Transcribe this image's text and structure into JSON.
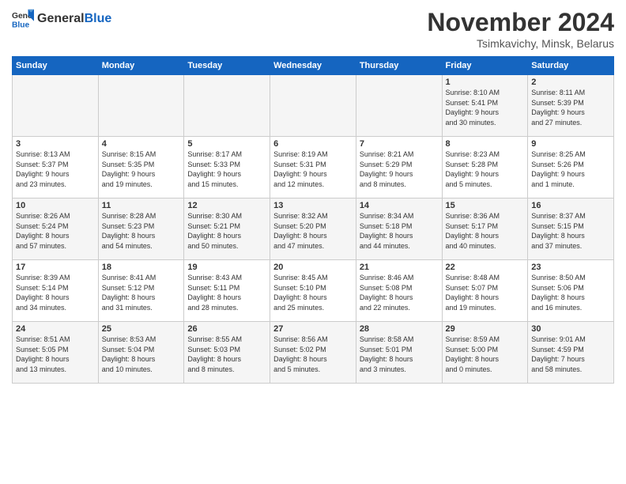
{
  "header": {
    "logo_general": "General",
    "logo_blue": "Blue",
    "month_title": "November 2024",
    "location": "Tsimkavichy, Minsk, Belarus"
  },
  "weekdays": [
    "Sunday",
    "Monday",
    "Tuesday",
    "Wednesday",
    "Thursday",
    "Friday",
    "Saturday"
  ],
  "weeks": [
    [
      {
        "day": "",
        "info": ""
      },
      {
        "day": "",
        "info": ""
      },
      {
        "day": "",
        "info": ""
      },
      {
        "day": "",
        "info": ""
      },
      {
        "day": "",
        "info": ""
      },
      {
        "day": "1",
        "info": "Sunrise: 8:10 AM\nSunset: 5:41 PM\nDaylight: 9 hours\nand 30 minutes."
      },
      {
        "day": "2",
        "info": "Sunrise: 8:11 AM\nSunset: 5:39 PM\nDaylight: 9 hours\nand 27 minutes."
      }
    ],
    [
      {
        "day": "3",
        "info": "Sunrise: 8:13 AM\nSunset: 5:37 PM\nDaylight: 9 hours\nand 23 minutes."
      },
      {
        "day": "4",
        "info": "Sunrise: 8:15 AM\nSunset: 5:35 PM\nDaylight: 9 hours\nand 19 minutes."
      },
      {
        "day": "5",
        "info": "Sunrise: 8:17 AM\nSunset: 5:33 PM\nDaylight: 9 hours\nand 15 minutes."
      },
      {
        "day": "6",
        "info": "Sunrise: 8:19 AM\nSunset: 5:31 PM\nDaylight: 9 hours\nand 12 minutes."
      },
      {
        "day": "7",
        "info": "Sunrise: 8:21 AM\nSunset: 5:29 PM\nDaylight: 9 hours\nand 8 minutes."
      },
      {
        "day": "8",
        "info": "Sunrise: 8:23 AM\nSunset: 5:28 PM\nDaylight: 9 hours\nand 5 minutes."
      },
      {
        "day": "9",
        "info": "Sunrise: 8:25 AM\nSunset: 5:26 PM\nDaylight: 9 hours\nand 1 minute."
      }
    ],
    [
      {
        "day": "10",
        "info": "Sunrise: 8:26 AM\nSunset: 5:24 PM\nDaylight: 8 hours\nand 57 minutes."
      },
      {
        "day": "11",
        "info": "Sunrise: 8:28 AM\nSunset: 5:23 PM\nDaylight: 8 hours\nand 54 minutes."
      },
      {
        "day": "12",
        "info": "Sunrise: 8:30 AM\nSunset: 5:21 PM\nDaylight: 8 hours\nand 50 minutes."
      },
      {
        "day": "13",
        "info": "Sunrise: 8:32 AM\nSunset: 5:20 PM\nDaylight: 8 hours\nand 47 minutes."
      },
      {
        "day": "14",
        "info": "Sunrise: 8:34 AM\nSunset: 5:18 PM\nDaylight: 8 hours\nand 44 minutes."
      },
      {
        "day": "15",
        "info": "Sunrise: 8:36 AM\nSunset: 5:17 PM\nDaylight: 8 hours\nand 40 minutes."
      },
      {
        "day": "16",
        "info": "Sunrise: 8:37 AM\nSunset: 5:15 PM\nDaylight: 8 hours\nand 37 minutes."
      }
    ],
    [
      {
        "day": "17",
        "info": "Sunrise: 8:39 AM\nSunset: 5:14 PM\nDaylight: 8 hours\nand 34 minutes."
      },
      {
        "day": "18",
        "info": "Sunrise: 8:41 AM\nSunset: 5:12 PM\nDaylight: 8 hours\nand 31 minutes."
      },
      {
        "day": "19",
        "info": "Sunrise: 8:43 AM\nSunset: 5:11 PM\nDaylight: 8 hours\nand 28 minutes."
      },
      {
        "day": "20",
        "info": "Sunrise: 8:45 AM\nSunset: 5:10 PM\nDaylight: 8 hours\nand 25 minutes."
      },
      {
        "day": "21",
        "info": "Sunrise: 8:46 AM\nSunset: 5:08 PM\nDaylight: 8 hours\nand 22 minutes."
      },
      {
        "day": "22",
        "info": "Sunrise: 8:48 AM\nSunset: 5:07 PM\nDaylight: 8 hours\nand 19 minutes."
      },
      {
        "day": "23",
        "info": "Sunrise: 8:50 AM\nSunset: 5:06 PM\nDaylight: 8 hours\nand 16 minutes."
      }
    ],
    [
      {
        "day": "24",
        "info": "Sunrise: 8:51 AM\nSunset: 5:05 PM\nDaylight: 8 hours\nand 13 minutes."
      },
      {
        "day": "25",
        "info": "Sunrise: 8:53 AM\nSunset: 5:04 PM\nDaylight: 8 hours\nand 10 minutes."
      },
      {
        "day": "26",
        "info": "Sunrise: 8:55 AM\nSunset: 5:03 PM\nDaylight: 8 hours\nand 8 minutes."
      },
      {
        "day": "27",
        "info": "Sunrise: 8:56 AM\nSunset: 5:02 PM\nDaylight: 8 hours\nand 5 minutes."
      },
      {
        "day": "28",
        "info": "Sunrise: 8:58 AM\nSunset: 5:01 PM\nDaylight: 8 hours\nand 3 minutes."
      },
      {
        "day": "29",
        "info": "Sunrise: 8:59 AM\nSunset: 5:00 PM\nDaylight: 8 hours\nand 0 minutes."
      },
      {
        "day": "30",
        "info": "Sunrise: 9:01 AM\nSunset: 4:59 PM\nDaylight: 7 hours\nand 58 minutes."
      }
    ]
  ]
}
